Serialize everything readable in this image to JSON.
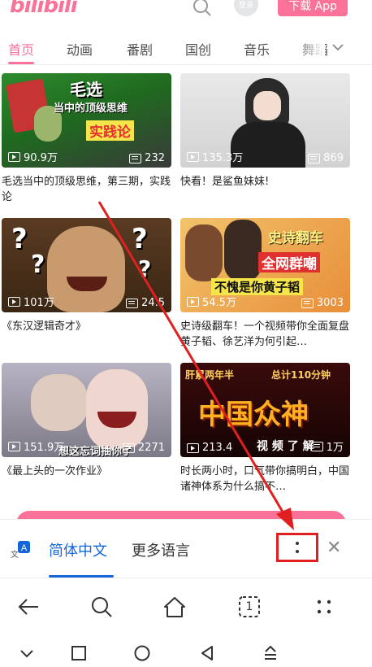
{
  "header": {
    "logo_text": "bilibili",
    "login_label": "登录",
    "download_label": "下载 App"
  },
  "tabs": [
    {
      "label": "首页",
      "active": true
    },
    {
      "label": "动画"
    },
    {
      "label": "番剧"
    },
    {
      "label": "国创"
    },
    {
      "label": "音乐"
    },
    {
      "label": "舞蹈"
    }
  ],
  "feed": [
    {
      "views": "90.9万",
      "comments": "232",
      "title": "毛选当中的顶级思维，第三期，实践论",
      "overlay": [
        "毛选",
        "当中的顶级思维",
        "实践论"
      ]
    },
    {
      "views": "135.3万",
      "comments": "869",
      "title": "快看！是鲨鱼妹妹!"
    },
    {
      "views": "101万",
      "comments": "24.5",
      "title": "《东汉逻辑奇才》"
    },
    {
      "views": "54.5万",
      "comments": "3003",
      "title": "史诗级翻车！一个视频带你全面复盘黄子韬、徐艺洋为何引起…",
      "overlay": [
        "史诗翻车",
        "全网群嘲",
        "不愧是你黄子韬"
      ]
    },
    {
      "views": "151.9万",
      "comments": "2271",
      "title": "《最上头的一次作业》",
      "overlay": [
        "想这忘词抽你了"
      ]
    },
    {
      "views": "213.4",
      "comments": "1万",
      "title": "时长两小时，口气带你搞明白，中国诸神体系为什么搞不…",
      "overlay": [
        "肝累两年半",
        "总计110分钟",
        "中国众神",
        "视 频 了 解"
      ]
    }
  ],
  "translate_bar": {
    "tab_active": "简体中文",
    "tab_other": "更多语言",
    "icon_letter": "A",
    "icon_glyph": "文"
  },
  "browser_bar": {
    "tabs_count": "1"
  },
  "colors": {
    "brand_pink": "#fb7299",
    "translate_blue": "#1565d8",
    "highlight_red": "#e02020"
  }
}
